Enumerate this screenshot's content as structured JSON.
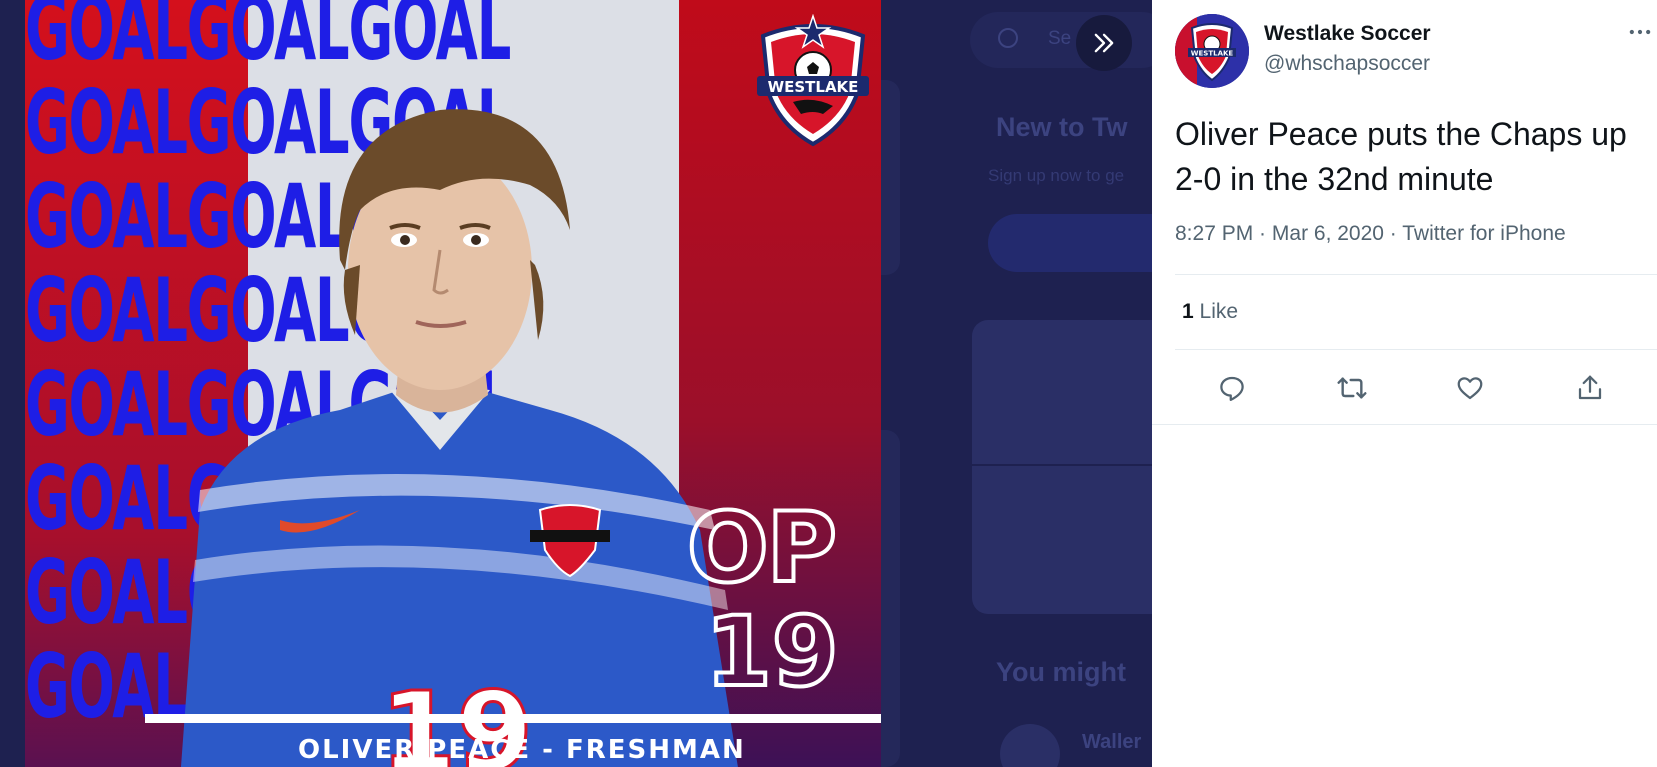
{
  "background": {
    "search_placeholder": "Se",
    "new_to_heading": "New to Tw",
    "signup_text": "Sign up now to ge",
    "you_might_heading": "You might",
    "suggested_user": "Waller"
  },
  "media": {
    "pattern_word": "GOALGOALGOAL",
    "crest_text": "WESTLAKE",
    "player_initials": "OP",
    "jersey_number": "19",
    "caption": "OLIVER PEACE - FRESHMAN"
  },
  "tweet": {
    "display_name": "Westlake Soccer",
    "handle": "@whschapsoccer",
    "avatar_label": "WESTLAKE",
    "text": "Oliver Peace puts the Chaps up 2-0 in the 32nd minute",
    "time": "8:27 PM",
    "date": "Mar 6, 2020",
    "source": "Twitter for iPhone",
    "separator": " · ",
    "like_count": "1",
    "like_label": "Like"
  },
  "colors": {
    "brand_red": "#c00b1a",
    "brand_blue": "#1e1ee6",
    "tweet_text": "#0f1419",
    "muted_text": "#536471",
    "icon_gray": "#536471"
  }
}
